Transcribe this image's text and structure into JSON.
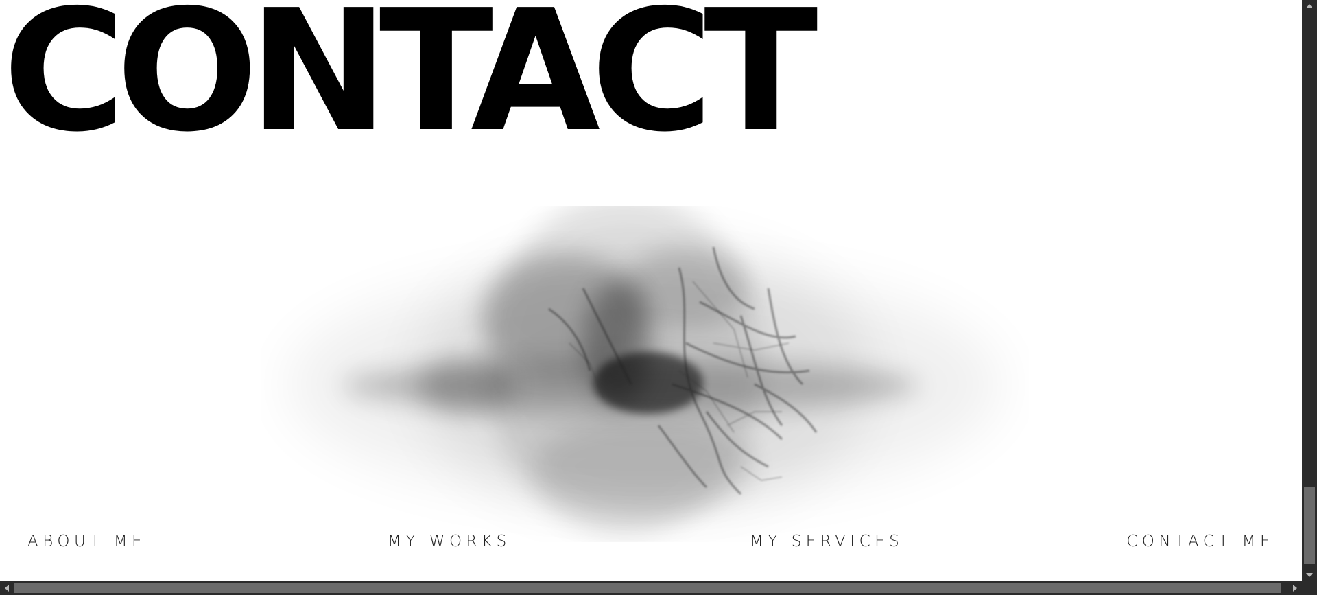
{
  "page": {
    "title": "CONTACT"
  },
  "hero": {
    "image_subject": "face-with-branch-shadows"
  },
  "footer_nav": {
    "items": [
      {
        "label": "ABOUT ME"
      },
      {
        "label": "MY WORKS"
      },
      {
        "label": "MY SERVICES"
      },
      {
        "label": "CONTACT ME"
      }
    ]
  },
  "scrollbars": {
    "vertical": {
      "arrow_up_icon": "triangle-up-icon",
      "arrow_down_icon": "triangle-down-icon"
    },
    "horizontal": {
      "arrow_left_icon": "triangle-left-icon",
      "arrow_right_icon": "triangle-right-icon"
    }
  },
  "colors": {
    "background": "#ffffff",
    "title_text": "#000000",
    "nav_text": "#222222",
    "divider": "#e6e6e6",
    "scrollbar_track": "#2b2b2b",
    "scrollbar_thumb": "#6b6b6b"
  }
}
